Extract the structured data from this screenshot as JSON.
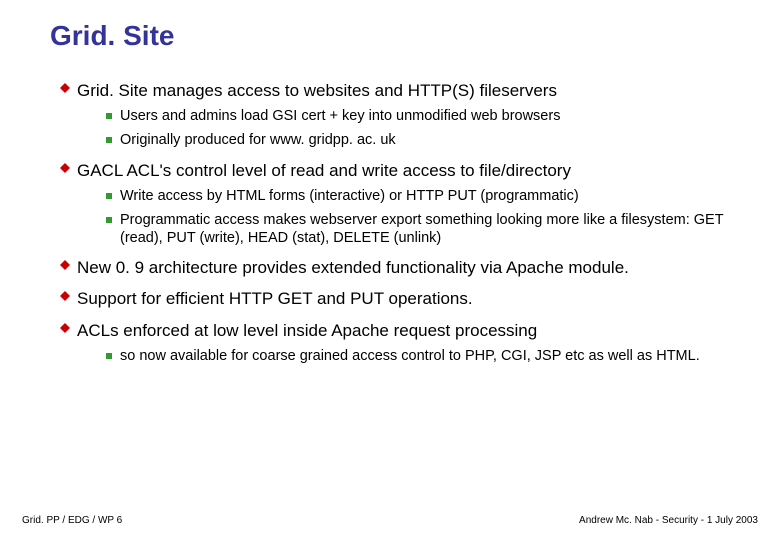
{
  "title": "Grid. Site",
  "bullets": [
    {
      "text": "Grid. Site manages access to websites and HTTP(S) fileservers",
      "children": [
        {
          "text": "Users and admins load GSI cert + key into unmodified web browsers"
        },
        {
          "text": "Originally produced for www. gridpp. ac. uk"
        }
      ]
    },
    {
      "text": "GACL ACL's control level of read and write access to file/directory",
      "children": [
        {
          "text": "Write access by HTML forms (interactive) or HTTP PUT (programmatic)"
        },
        {
          "text": "Programmatic access makes webserver export something looking more like a filesystem: GET (read), PUT (write), HEAD (stat), DELETE (unlink)"
        }
      ]
    },
    {
      "text": "New 0. 9 architecture provides extended functionality via Apache module.",
      "children": []
    },
    {
      "text": "Support for efficient HTTP GET and PUT operations.",
      "children": []
    },
    {
      "text": "ACLs enforced at low level inside Apache request processing",
      "children": [
        {
          "text": "so now available for coarse grained access control to PHP, CGI, JSP etc as well as HTML."
        }
      ]
    }
  ],
  "footer": {
    "left": "Grid. PP / EDG / WP 6",
    "right": "Andrew Mc. Nab - Security - 1 July 2003"
  },
  "colors": {
    "title": "#333399",
    "diamond": "#cc0000",
    "square": "#339933"
  }
}
